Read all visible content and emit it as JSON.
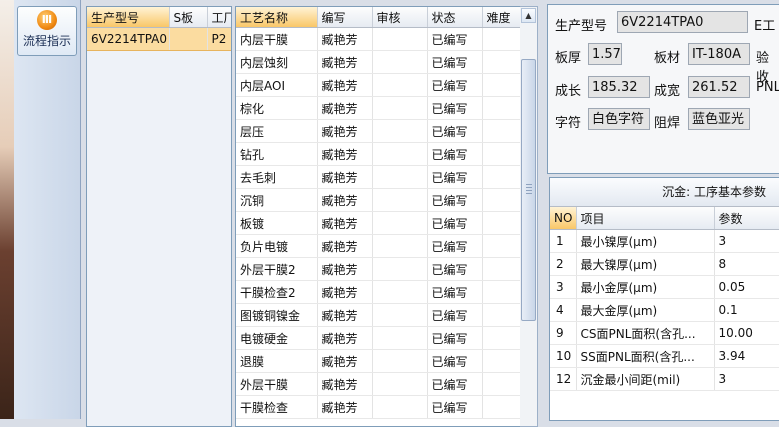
{
  "flow_button": {
    "label": "流程指示"
  },
  "orders": {
    "columns": [
      "生产型号",
      "S板",
      "工厂"
    ],
    "rows": [
      {
        "model": "6V2214TPA0",
        "s": "",
        "f": "P2"
      }
    ]
  },
  "process": {
    "columns": [
      "工艺名称",
      "编写",
      "审核",
      "状态",
      "难度"
    ],
    "rows": [
      {
        "name": "内层干膜",
        "writer": "臧艳芳",
        "review": "",
        "status": "已编写",
        "diff": ""
      },
      {
        "name": "内层蚀刻",
        "writer": "臧艳芳",
        "review": "",
        "status": "已编写",
        "diff": ""
      },
      {
        "name": "内层AOI",
        "writer": "臧艳芳",
        "review": "",
        "status": "已编写",
        "diff": ""
      },
      {
        "name": "棕化",
        "writer": "臧艳芳",
        "review": "",
        "status": "已编写",
        "diff": ""
      },
      {
        "name": "层压",
        "writer": "臧艳芳",
        "review": "",
        "status": "已编写",
        "diff": ""
      },
      {
        "name": "钻孔",
        "writer": "臧艳芳",
        "review": "",
        "status": "已编写",
        "diff": ""
      },
      {
        "name": "去毛刺",
        "writer": "臧艳芳",
        "review": "",
        "status": "已编写",
        "diff": ""
      },
      {
        "name": "沉铜",
        "writer": "臧艳芳",
        "review": "",
        "status": "已编写",
        "diff": ""
      },
      {
        "name": "板镀",
        "writer": "臧艳芳",
        "review": "",
        "status": "已编写",
        "diff": ""
      },
      {
        "name": "负片电镀",
        "writer": "臧艳芳",
        "review": "",
        "status": "已编写",
        "diff": ""
      },
      {
        "name": "外层干膜2",
        "writer": "臧艳芳",
        "review": "",
        "status": "已编写",
        "diff": ""
      },
      {
        "name": "干膜检查2",
        "writer": "臧艳芳",
        "review": "",
        "status": "已编写",
        "diff": ""
      },
      {
        "name": "图镀铜镍金",
        "writer": "臧艳芳",
        "review": "",
        "status": "已编写",
        "diff": ""
      },
      {
        "name": "电镀硬金",
        "writer": "臧艳芳",
        "review": "",
        "status": "已编写",
        "diff": ""
      },
      {
        "name": "退膜",
        "writer": "臧艳芳",
        "review": "",
        "status": "已编写",
        "diff": ""
      },
      {
        "name": "外层干膜",
        "writer": "臧艳芳",
        "review": "",
        "status": "已编写",
        "diff": ""
      },
      {
        "name": "干膜检查",
        "writer": "臧艳芳",
        "review": "",
        "status": "已编写",
        "diff": ""
      }
    ]
  },
  "info": {
    "model_label": "生产型号",
    "model_value": "6V2214TPA0",
    "model_extra": "E工",
    "thick_label": "板厚",
    "thick_value": "1.57",
    "material_label": "板材",
    "material_value": "IT-180A",
    "check_label": "验收",
    "len_label": "成长",
    "len_value": "185.32",
    "width_label": "成宽",
    "width_value": "261.52",
    "pnl_label": "PNL",
    "char_label": "字符",
    "char_value": "白色字符",
    "mask_label": "阻焊",
    "mask_value": "蓝色亚光"
  },
  "params": {
    "title": "沉金: 工序基本参数",
    "columns": [
      "NO",
      "项目",
      "参数"
    ],
    "rows": [
      {
        "no": "1",
        "item": "最小镍厚(μm)",
        "value": "3"
      },
      {
        "no": "2",
        "item": "最大镍厚(μm)",
        "value": "8"
      },
      {
        "no": "3",
        "item": "最小金厚(μm)",
        "value": "0.05"
      },
      {
        "no": "4",
        "item": "最大金厚(μm)",
        "value": "0.1"
      },
      {
        "no": "9",
        "item": "CS面PNL面积(含孔...",
        "value": "10.00"
      },
      {
        "no": "10",
        "item": "SS面PNL面积(含孔...",
        "value": "3.94"
      },
      {
        "no": "12",
        "item": "沉金最小间距(mil)",
        "value": "3"
      }
    ]
  },
  "colors": {
    "header_highlight": "#f9c768",
    "selected_row": "#fce2a6",
    "border": "#7f9db9"
  }
}
